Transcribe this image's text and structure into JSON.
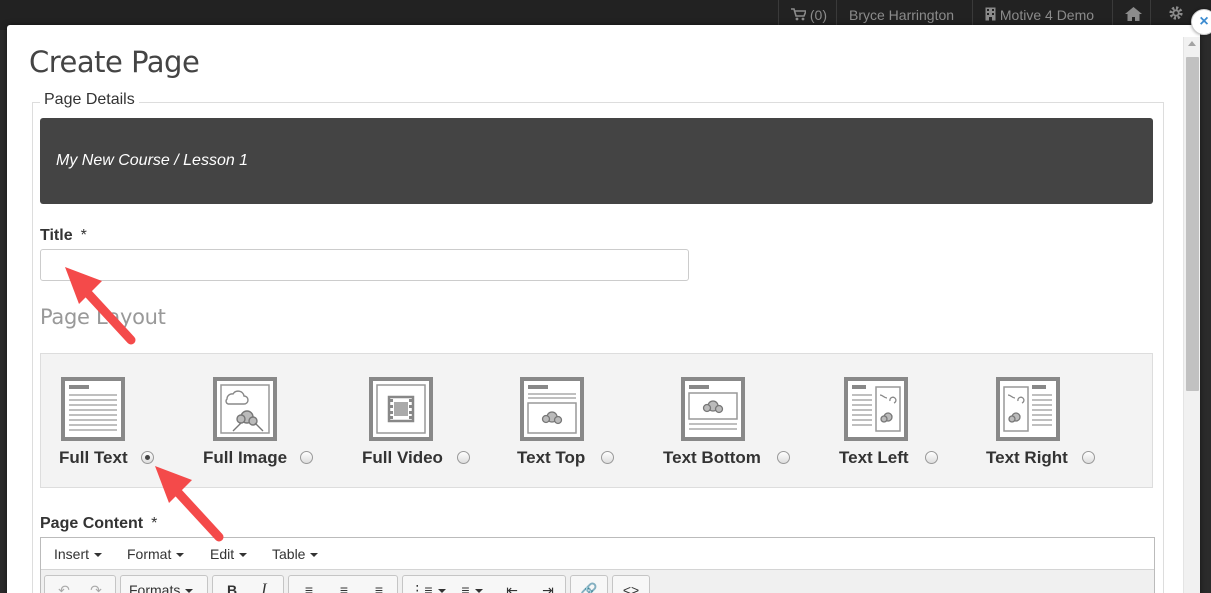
{
  "topbar": {
    "cart_label": "(0)",
    "user_name": "Bryce Harrington",
    "org_name": "Motive 4 Demo",
    "icons": [
      "cart-icon",
      "building-icon",
      "home-icon",
      "gear-icon"
    ]
  },
  "modal": {
    "title": "Create Page",
    "close_label": "×",
    "fieldset_legend": "Page Details",
    "breadcrumb": "My New Course / Lesson 1",
    "title_field": {
      "label": "Title",
      "required_mark": "*",
      "value": "",
      "placeholder": ""
    },
    "page_layout": {
      "heading": "Page Layout",
      "options": [
        {
          "label": "Full Text",
          "icon": "full-text-layout-icon",
          "selected": true
        },
        {
          "label": "Full Image",
          "icon": "full-image-layout-icon",
          "selected": false
        },
        {
          "label": "Full Video",
          "icon": "full-video-layout-icon",
          "selected": false
        },
        {
          "label": "Text Top",
          "icon": "text-top-layout-icon",
          "selected": false
        },
        {
          "label": "Text Bottom",
          "icon": "text-bottom-layout-icon",
          "selected": false
        },
        {
          "label": "Text Left",
          "icon": "text-left-layout-icon",
          "selected": false
        },
        {
          "label": "Text Right",
          "icon": "text-right-layout-icon",
          "selected": false
        }
      ]
    },
    "page_content": {
      "label": "Page Content",
      "required_mark": "*",
      "menu": [
        "Insert",
        "Format",
        "Edit",
        "Table"
      ],
      "toolbar": {
        "formats_label": "Formats",
        "bold": "B",
        "italic": "I",
        "code": "<>"
      }
    }
  },
  "colors": {
    "topbar": "#222222",
    "banner": "#444444",
    "annotation_arrow": "#f44a4a",
    "close_icon": "#3b8bd0"
  }
}
